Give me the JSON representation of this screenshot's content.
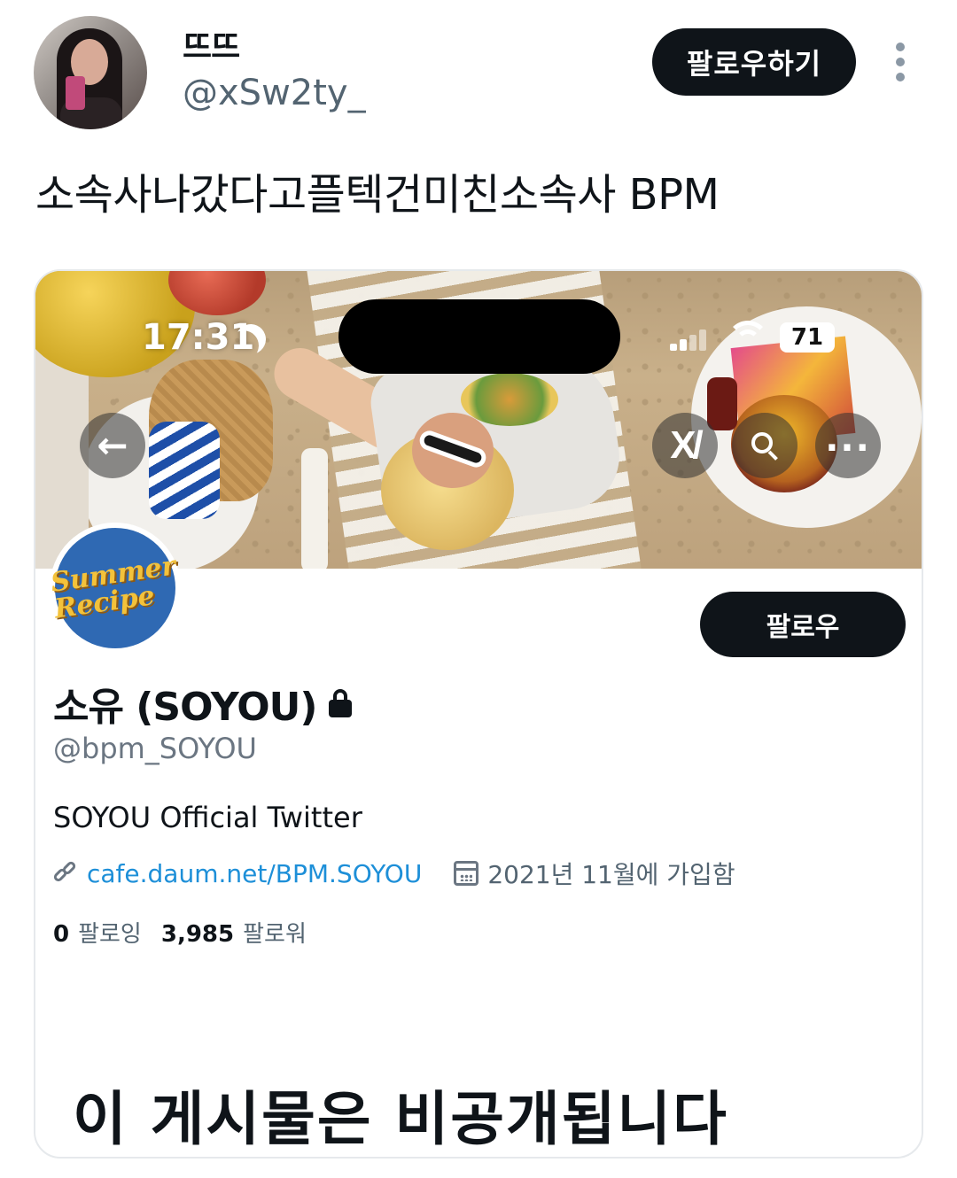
{
  "tweet": {
    "display_name": "뜨뜨",
    "handle": "@xSw2ty_",
    "follow_label": "팔로우하기",
    "more_icon": "more-vertical-icon",
    "text": "소속사나갔다고플텍건미친소속사 BPM"
  },
  "screenshot": {
    "status_bar": {
      "time": "17:31",
      "battery": "71"
    },
    "profile": {
      "avatar_text": "Summer Recipe",
      "follow_label": "팔로우",
      "name": "소유 (SOYOU)",
      "handle": "@bpm_SOYOU",
      "bio": "SOYOU Official Twitter",
      "link": "cafe.daum.net/BPM.SOYOU",
      "joined": "2021년 11월에 가입함",
      "following_count": "0",
      "following_label": "팔로잉",
      "followers_count": "3,985",
      "followers_label": "팔로워"
    },
    "overlay_caption": "이 게시물은 비공개됩니다"
  },
  "colors": {
    "button_bg": "#0f1419",
    "link": "#1d8fd8",
    "secondary_text": "#536471",
    "avatar_blue": "#2f69b3",
    "logo_yellow": "#f3c23b"
  }
}
